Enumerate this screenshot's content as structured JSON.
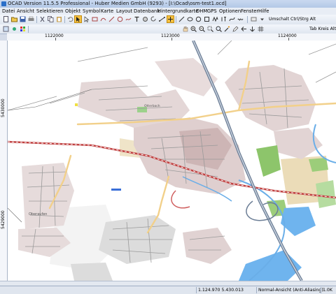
{
  "window": {
    "title": "OCAD Version 11.5.5  Professional - Huber Medien GmbH (9293) - [I:\\Ocad\\osm-test1.ocd]"
  },
  "menu": {
    "items": [
      "Datei",
      "Ansicht",
      "Selektieren",
      "Objekt",
      "Symbol",
      "Karte",
      "Layout",
      "Datenbank",
      "Hintergrundkarte",
      "DHM",
      "GPS",
      "Optionen",
      "Fenster",
      "Hilfe"
    ]
  },
  "toolbar": {
    "mode_text": "Umschalt  Ctrl/Strg  Alt",
    "tab_text": "Tab  Kreis  Alt"
  },
  "ruler": {
    "x_labels": [
      "1122000",
      "1123000",
      "1124000"
    ],
    "y_labels": [
      "5430000",
      "5429000"
    ]
  },
  "map_labels": {
    "town": "Oberaufen",
    "estate": "Otterbach"
  },
  "status": {
    "coords": "1.124.970   5.430.013",
    "view_mode": "Normal-Ansicht (Anti-Aliasing)",
    "page": "1.0K"
  },
  "colors": {
    "accent": "#2a6fc9",
    "road_main": "#f2d08a",
    "railway": "#d06060",
    "highway": "#6b7d95",
    "river": "#6aaee8",
    "water": "#6fb4ee",
    "built": "#e3d6d6",
    "forest": "#8dc56b",
    "field": "#e8dcc0"
  }
}
